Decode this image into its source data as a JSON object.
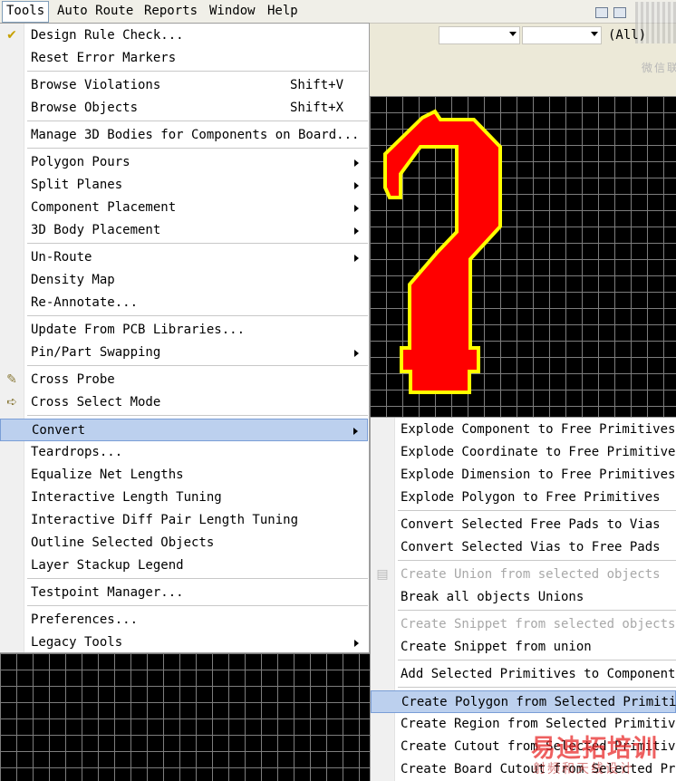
{
  "menubar": {
    "items": [
      {
        "name": "tools",
        "label": "Tools"
      },
      {
        "name": "auto-route",
        "label": "Auto Route"
      },
      {
        "name": "reports",
        "label": "Reports"
      },
      {
        "name": "window",
        "label": "Window"
      },
      {
        "name": "help",
        "label": "Help"
      }
    ]
  },
  "toolbar": {
    "filter_value": "(All)",
    "combo1_value": "",
    "combo2_value": ""
  },
  "watermark": {
    "small": "微信联系",
    "big": "易迪拓培训",
    "big_sub": "射频和天线设计"
  },
  "tools_menu": {
    "items": [
      {
        "label": "Design Rule Check...",
        "shortcut": "",
        "submenu": false,
        "icon": "drc-check-icon"
      },
      {
        "label": "Reset Error Markers",
        "shortcut": "",
        "submenu": false,
        "icon": ""
      },
      {
        "label": "Browse Violations",
        "shortcut": "Shift+V",
        "submenu": false,
        "icon": ""
      },
      {
        "label": "Browse Objects",
        "shortcut": "Shift+X",
        "submenu": false,
        "icon": ""
      },
      {
        "label": "Manage 3D Bodies for Components on Board...",
        "shortcut": "",
        "submenu": false,
        "icon": ""
      },
      {
        "label": "Polygon Pours",
        "shortcut": "",
        "submenu": true,
        "icon": ""
      },
      {
        "label": "Split Planes",
        "shortcut": "",
        "submenu": true,
        "icon": ""
      },
      {
        "label": "Component Placement",
        "shortcut": "",
        "submenu": true,
        "icon": ""
      },
      {
        "label": "3D Body Placement",
        "shortcut": "",
        "submenu": true,
        "icon": ""
      },
      {
        "label": "Un-Route",
        "shortcut": "",
        "submenu": true,
        "icon": ""
      },
      {
        "label": "Density Map",
        "shortcut": "",
        "submenu": false,
        "icon": ""
      },
      {
        "label": "Re-Annotate...",
        "shortcut": "",
        "submenu": false,
        "icon": ""
      },
      {
        "label": "Update From PCB Libraries...",
        "shortcut": "",
        "submenu": false,
        "icon": ""
      },
      {
        "label": "Pin/Part Swapping",
        "shortcut": "",
        "submenu": true,
        "icon": ""
      },
      {
        "label": "Cross Probe",
        "shortcut": "",
        "submenu": false,
        "icon": "cross-probe-icon"
      },
      {
        "label": "Cross Select Mode",
        "shortcut": "",
        "submenu": false,
        "icon": "cross-select-icon"
      },
      {
        "label": "Convert",
        "shortcut": "",
        "submenu": true,
        "icon": "",
        "highlighted": true
      },
      {
        "label": "Teardrops...",
        "shortcut": "",
        "submenu": false,
        "icon": ""
      },
      {
        "label": "Equalize Net Lengths",
        "shortcut": "",
        "submenu": false,
        "icon": ""
      },
      {
        "label": "Interactive Length Tuning",
        "shortcut": "",
        "submenu": false,
        "icon": ""
      },
      {
        "label": "Interactive Diff Pair Length Tuning",
        "shortcut": "",
        "submenu": false,
        "icon": ""
      },
      {
        "label": "Outline Selected Objects",
        "shortcut": "",
        "submenu": false,
        "icon": ""
      },
      {
        "label": "Layer Stackup Legend",
        "shortcut": "",
        "submenu": false,
        "icon": ""
      },
      {
        "label": "Testpoint Manager...",
        "shortcut": "",
        "submenu": false,
        "icon": ""
      },
      {
        "label": "Preferences...",
        "shortcut": "",
        "submenu": false,
        "icon": ""
      },
      {
        "label": "Legacy Tools",
        "shortcut": "",
        "submenu": true,
        "icon": ""
      }
    ]
  },
  "convert_menu": {
    "items": [
      {
        "label": "Explode Component to Free Primitives",
        "disabled": false
      },
      {
        "label": "Explode Coordinate to Free Primitives",
        "disabled": false
      },
      {
        "label": "Explode Dimension to Free Primitives",
        "disabled": false
      },
      {
        "label": "Explode Polygon to Free Primitives",
        "disabled": false
      },
      {
        "label": "Convert Selected Free Pads to Vias",
        "disabled": false
      },
      {
        "label": "Convert Selected Vias to Free Pads",
        "disabled": false
      },
      {
        "label": "Create Union from selected objects",
        "disabled": true
      },
      {
        "label": "Break all objects Unions",
        "disabled": false
      },
      {
        "label": "Create Snippet from selected objects",
        "disabled": true
      },
      {
        "label": "Create Snippet from union",
        "disabled": false
      },
      {
        "label": "Add Selected Primitives to Component",
        "disabled": false
      },
      {
        "label": "Create Polygon from Selected Primitive",
        "disabled": false,
        "highlighted": true
      },
      {
        "label": "Create Region from Selected Primitives",
        "disabled": false
      },
      {
        "label": "Create Cutout from Selected Primitives",
        "disabled": false
      },
      {
        "label": "Create Board Cutout from Selected Primitives",
        "disabled": false
      }
    ]
  },
  "colors": {
    "highlight": "#bcd0ee",
    "canvas": "#000000",
    "question_fill": "#ff0000",
    "question_stroke": "#ffff00"
  }
}
